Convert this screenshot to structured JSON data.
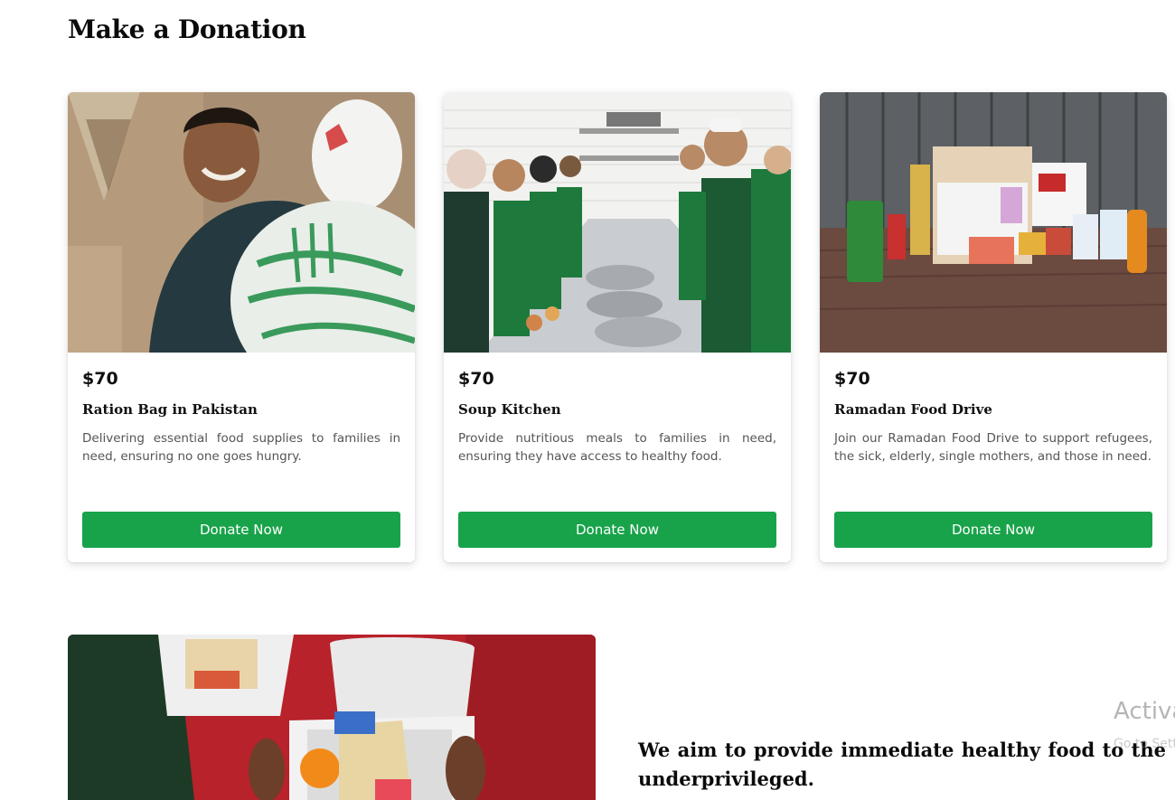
{
  "section": {
    "title": "Make a Donation"
  },
  "cards": [
    {
      "price": "$70",
      "name": "Ration Bag in Pakistan",
      "description": "Delivering essential food supplies to families in need, ensuring no one goes hungry.",
      "button_label": "Donate Now",
      "image_alt": "Smiling boy carrying a ration bag"
    },
    {
      "price": "$70",
      "name": "Soup Kitchen",
      "description": "Provide nutritious meals to families in need, ensuring they have access to healthy food.",
      "button_label": "Donate Now",
      "image_alt": "Volunteers preparing food in a kitchen"
    },
    {
      "price": "$70",
      "name": "Ramadan Food Drive",
      "description": "Join our Ramadan Food Drive to support refugees, the sick, elderly, single mothers, and those in need.",
      "button_label": "Donate Now",
      "image_alt": "Box of groceries on a wooden deck"
    }
  ],
  "mission": {
    "text": "We aim to provide immediate healthy food to the underprivileged."
  },
  "watermark": {
    "title": "Activate Windows",
    "subtitle": "Go to Settings to activate Windows."
  },
  "colors": {
    "accent": "#18a34a",
    "heading": "#0b0b0b",
    "body_text": "#555555"
  }
}
